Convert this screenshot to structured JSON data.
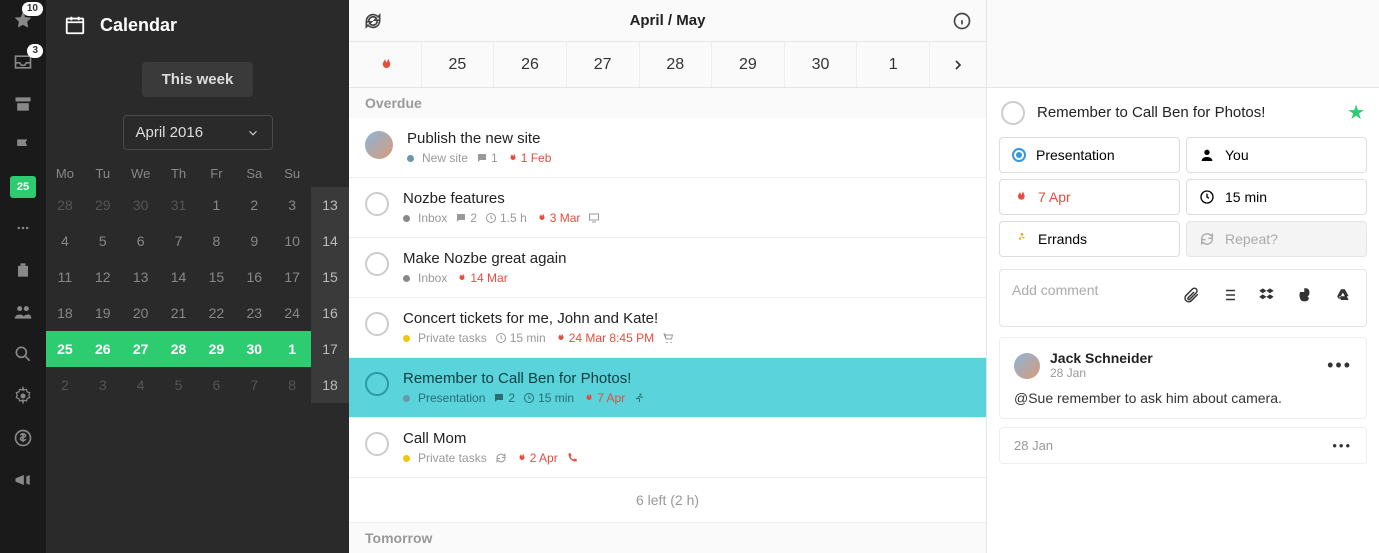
{
  "rail": {
    "badges": {
      "star": "10",
      "inbox": "3"
    },
    "calendar_day": "25"
  },
  "sidebar": {
    "title": "Calendar",
    "this_week": "This week",
    "month_label": "April 2016",
    "weekdays": [
      "Mo",
      "Tu",
      "We",
      "Th",
      "Fr",
      "Sa",
      "Su",
      ""
    ],
    "rows": [
      {
        "cells": [
          "28",
          "29",
          "30",
          "31",
          "1",
          "2",
          "3"
        ],
        "extra": "13",
        "dim_until": 4
      },
      {
        "cells": [
          "4",
          "5",
          "6",
          "7",
          "8",
          "9",
          "10"
        ],
        "extra": "14"
      },
      {
        "cells": [
          "11",
          "12",
          "13",
          "14",
          "15",
          "16",
          "17"
        ],
        "extra": "15"
      },
      {
        "cells": [
          "18",
          "19",
          "20",
          "21",
          "22",
          "23",
          "24"
        ],
        "extra": "16"
      },
      {
        "cells": [
          "25",
          "26",
          "27",
          "28",
          "29",
          "30",
          "1"
        ],
        "extra": "17",
        "active": true
      },
      {
        "cells": [
          "2",
          "3",
          "4",
          "5",
          "6",
          "7",
          "8"
        ],
        "extra": "18",
        "dim_from": 0
      }
    ]
  },
  "main": {
    "period": "April / May",
    "days": [
      "25",
      "26",
      "27",
      "28",
      "29",
      "30",
      "1"
    ],
    "overdue_label": "Overdue",
    "tomorrow_label": "Tomorrow",
    "footer": "6 left (2 h)",
    "tasks": [
      {
        "title": "Publish the new site",
        "avatar": true,
        "dot": "blue",
        "project": "New site",
        "comments": "1",
        "due": "1 Feb"
      },
      {
        "title": "Nozbe features",
        "dot": "gray",
        "project": "Inbox",
        "comments": "2",
        "time": "1.5 h",
        "due": "3 Mar",
        "screen": true
      },
      {
        "title": "Make Nozbe great again",
        "dot": "gray",
        "project": "Inbox",
        "due": "14 Mar"
      },
      {
        "title": "Concert tickets for me, John and Kate!",
        "dot": "yellow",
        "project": "Private tasks",
        "time": "15 min",
        "due": "24 Mar 8:45 PM",
        "cart": true
      },
      {
        "title": "Remember to Call Ben for Photos!",
        "dot": "blue",
        "project": "Presentation",
        "comments": "2",
        "time": "15 min",
        "due": "7 Apr",
        "run": true,
        "highlight": true
      },
      {
        "title": "Call Mom",
        "dot": "yellow",
        "project": "Private tasks",
        "repeat": true,
        "due": "2 Apr",
        "phone": true
      }
    ]
  },
  "detail": {
    "title": "Remember to Call Ben for Photos!",
    "props": {
      "project": "Presentation",
      "assignee": "You",
      "due": "7 Apr",
      "time": "15 min",
      "category": "Errands",
      "repeat": "Repeat?"
    },
    "comment_placeholder": "Add comment",
    "comments": [
      {
        "author": "Jack Schneider",
        "date": "28 Jan",
        "text": "@Sue remember to ask him about camera."
      }
    ],
    "stub_date": "28 Jan"
  }
}
